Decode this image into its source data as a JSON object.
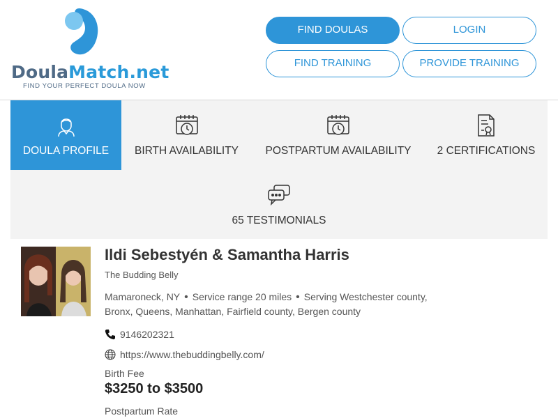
{
  "logo": {
    "name_part1": "Doula",
    "name_part2": "Match.net",
    "tagline": "FIND YOUR PERFECT DOULA NOW"
  },
  "nav": {
    "find_doulas": "FIND DOULAS",
    "login": "LOGIN",
    "find_training": "FIND TRAINING",
    "provide_training": "PROVIDE TRAINING"
  },
  "tabs": [
    {
      "label": "DOULA PROFILE",
      "icon": "doula-person-icon",
      "active": true
    },
    {
      "label": "BIRTH AVAILABILITY",
      "icon": "calendar-clock-icon",
      "active": false
    },
    {
      "label": "POSTPARTUM AVAILABILITY",
      "icon": "calendar-clock-icon",
      "active": false
    },
    {
      "label": "2 CERTIFICATIONS",
      "icon": "certificate-icon",
      "active": false
    },
    {
      "label": "65 TESTIMONIALS",
      "icon": "chat-bubbles-icon",
      "active": false
    }
  ],
  "profile": {
    "name": "Ildi Sebestyén & Samantha Harris",
    "business": "The Budding Belly",
    "city": "Mamaroneck, NY",
    "service_range": "Service range 20 miles",
    "serving": "Serving Westchester county, Bronx, Queens, Manhattan, Fairfield county, Bergen county",
    "phone": "9146202321",
    "website": "https://www.thebuddingbelly.com/",
    "birth_fee_label": "Birth Fee",
    "birth_fee_value": "$3250 to $3500",
    "postpartum_label": "Postpartum Rate"
  },
  "colors": {
    "brand_blue": "#2e95d8",
    "logo_dark": "#4f6a86",
    "tab_bg": "#f3f3f3"
  }
}
